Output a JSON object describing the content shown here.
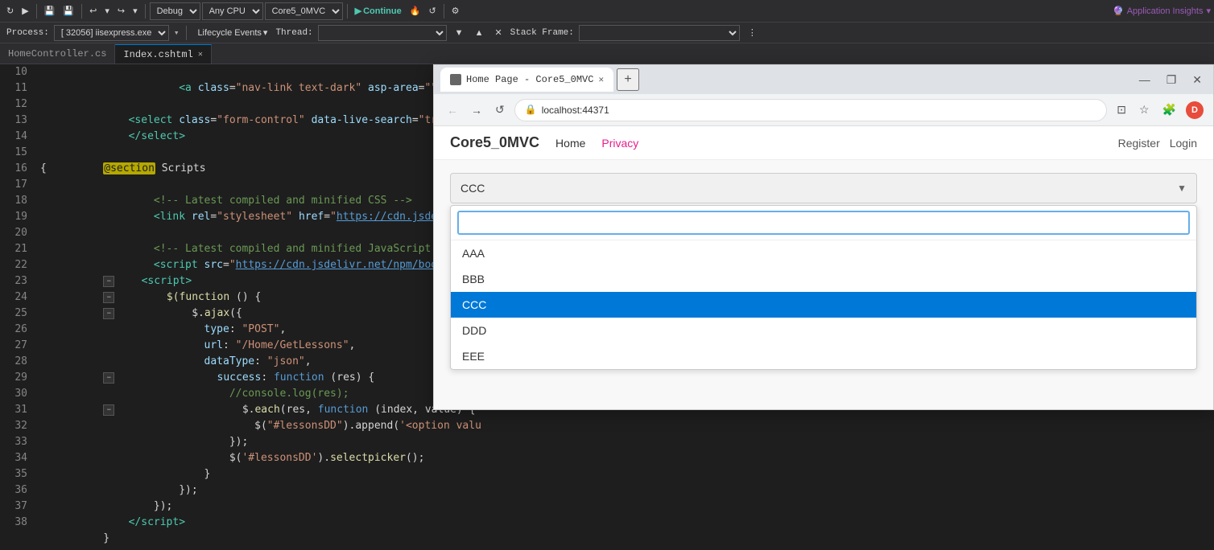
{
  "toolbar": {
    "debug_label": "Debug",
    "cpu_label": "Any CPU",
    "project_label": "Core5_0MVC",
    "continue_label": "Continue",
    "app_insights_label": "Application Insights"
  },
  "process_bar": {
    "label": "Process:",
    "pid": "[32056] iisexpress.exe",
    "lifecycle_label": "Lifecycle Events",
    "thread_label": "Thread:",
    "stack_frame_label": "Stack Frame:"
  },
  "tabs": [
    {
      "label": "HomeController.cs",
      "active": false,
      "closeable": false
    },
    {
      "label": "Index.cshtml",
      "active": true,
      "closeable": true
    }
  ],
  "code": {
    "lines": [
      {
        "num": "10",
        "content": ""
      },
      {
        "num": "11",
        "content": ""
      },
      {
        "num": "12",
        "content": ""
      },
      {
        "num": "13",
        "content": ""
      },
      {
        "num": "14",
        "content": ""
      },
      {
        "num": "15",
        "content": ""
      },
      {
        "num": "16",
        "content": ""
      },
      {
        "num": "17",
        "content": ""
      },
      {
        "num": "18",
        "content": ""
      },
      {
        "num": "19",
        "content": ""
      },
      {
        "num": "20",
        "content": ""
      },
      {
        "num": "21",
        "content": ""
      },
      {
        "num": "22",
        "content": ""
      },
      {
        "num": "23",
        "content": ""
      },
      {
        "num": "24",
        "content": ""
      },
      {
        "num": "25",
        "content": ""
      },
      {
        "num": "26",
        "content": ""
      },
      {
        "num": "27",
        "content": ""
      },
      {
        "num": "28",
        "content": ""
      },
      {
        "num": "29",
        "content": ""
      },
      {
        "num": "30",
        "content": ""
      },
      {
        "num": "31",
        "content": ""
      },
      {
        "num": "32",
        "content": ""
      },
      {
        "num": "33",
        "content": ""
      },
      {
        "num": "34",
        "content": ""
      },
      {
        "num": "35",
        "content": ""
      },
      {
        "num": "36",
        "content": ""
      },
      {
        "num": "37",
        "content": ""
      },
      {
        "num": "38",
        "content": ""
      }
    ]
  },
  "browser": {
    "tab_title": "Home Page - Core5_0MVC",
    "url": "localhost:44371",
    "site_brand": "Core5_0MVC",
    "nav_links": [
      "Home",
      "Privacy"
    ],
    "auth_links": [
      "Register",
      "Login"
    ],
    "select_value": "CCC",
    "dropdown_items": [
      "AAA",
      "BBB",
      "CCC",
      "DDD",
      "EEE"
    ],
    "selected_item": "CCC"
  }
}
